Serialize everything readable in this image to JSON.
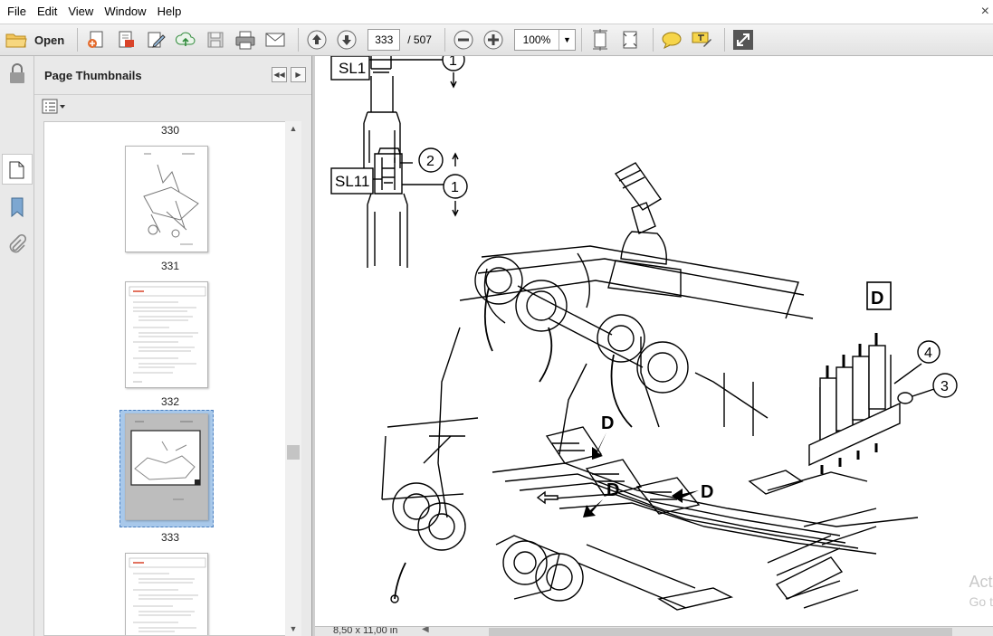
{
  "menubar": {
    "items": [
      "File",
      "Edit",
      "View",
      "Window",
      "Help"
    ],
    "close_glyph": "×"
  },
  "toolbar": {
    "open_label": "Open",
    "current_page": "333",
    "total_pages": "/ 507",
    "zoom": "100%",
    "icons": [
      "open-folder-icon",
      "create-pdf-icon",
      "export-pdf-icon",
      "edit-icon",
      "cloud-upload-icon",
      "save-icon",
      "print-icon",
      "email-icon",
      "previous-page-icon",
      "next-page-icon",
      "zoom-out-icon",
      "zoom-in-icon",
      "fit-page-icon",
      "full-screen-width-icon",
      "comment-icon",
      "highlight-icon",
      "expand-icon"
    ]
  },
  "left_rail": {
    "icons": [
      "lock-icon",
      "pages-icon",
      "bookmark-icon",
      "attachment-icon"
    ]
  },
  "thumbnails_panel": {
    "title": "Page Thumbnails",
    "pages": [
      {
        "label": "330",
        "selected": false
      },
      {
        "label": "331",
        "selected": false
      },
      {
        "label": "332",
        "selected": false
      },
      {
        "label": "333",
        "selected": true
      }
    ]
  },
  "document": {
    "callouts": {
      "sl1": "SL1",
      "sl11": "SL11",
      "one": "1",
      "two": "2",
      "three": "3",
      "four": "4",
      "d_box": "D",
      "d_label": "D"
    },
    "page_size": "8,50 x 11,00 in",
    "watermark_line1": "Act",
    "watermark_line2": "Go t"
  },
  "colors": {
    "toolbar_bg": "#e8e8e8",
    "panel_bg": "#e9e9e9",
    "selection": "#a8c8ea",
    "drawing_line": "#000000"
  }
}
